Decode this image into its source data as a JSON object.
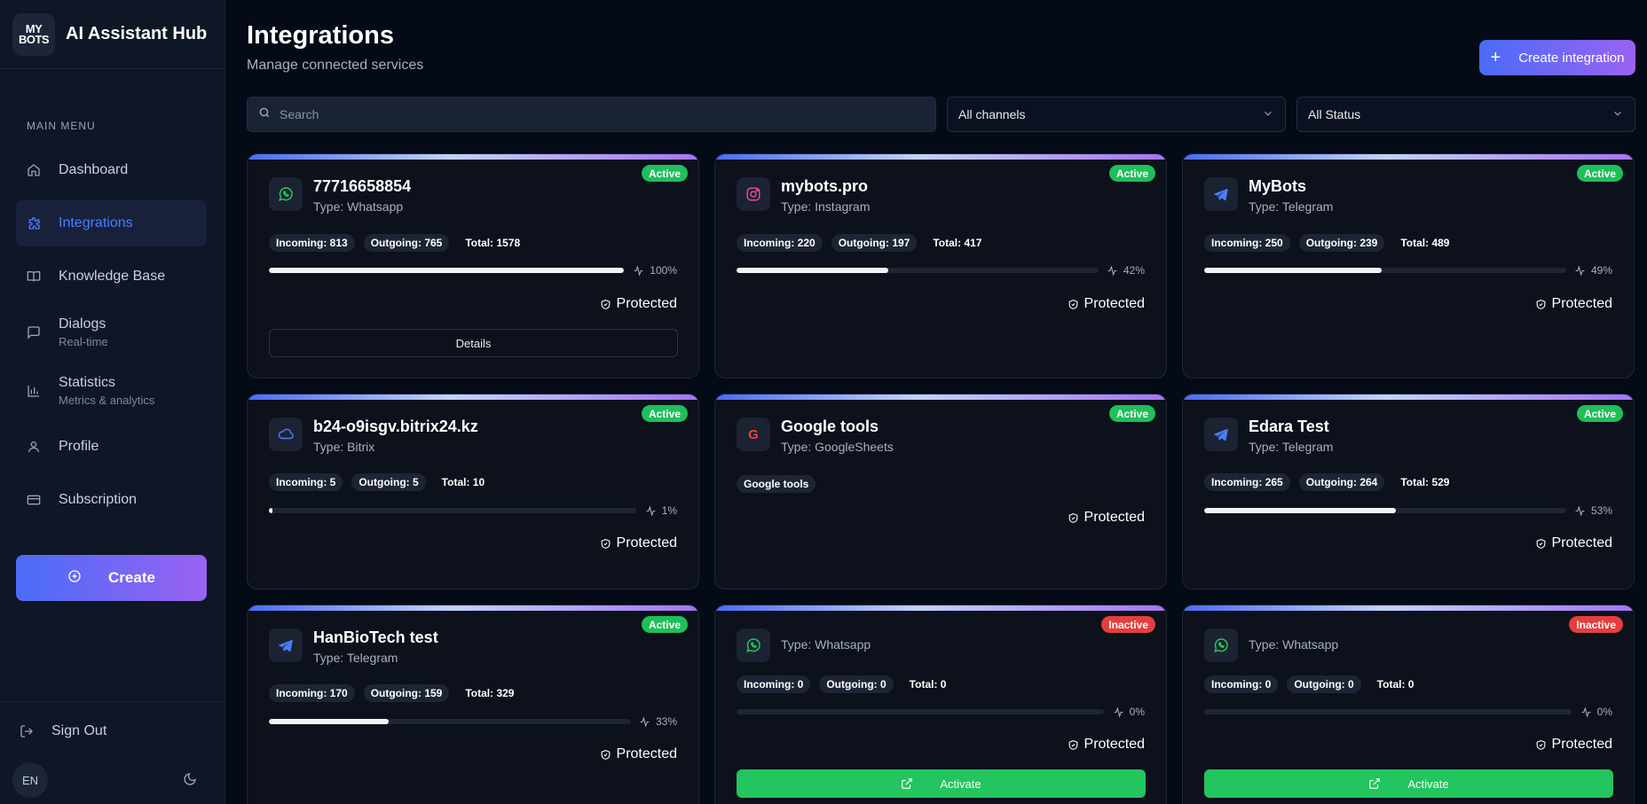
{
  "brand": {
    "logo_line1": "MY",
    "logo_line2": "BOTS",
    "name": "AI Assistant Hub"
  },
  "sidebar": {
    "menu_label": "MAIN MENU",
    "items": [
      {
        "label": "Dashboard",
        "sub": "",
        "icon": "home-icon"
      },
      {
        "label": "Integrations",
        "sub": "",
        "icon": "puzzle-icon",
        "active": true
      },
      {
        "label": "Knowledge Base",
        "sub": "",
        "icon": "book-icon"
      },
      {
        "label": "Dialogs",
        "sub": "Real-time",
        "icon": "message-icon"
      },
      {
        "label": "Statistics",
        "sub": "Metrics & analytics",
        "icon": "bar-chart-icon"
      },
      {
        "label": "Profile",
        "sub": "",
        "icon": "user-icon"
      },
      {
        "label": "Subscription",
        "sub": "",
        "icon": "credit-card-icon"
      }
    ],
    "create_label": "Create",
    "signout_label": "Sign Out",
    "lang": "EN"
  },
  "header": {
    "title": "Integrations",
    "subtitle": "Manage connected services",
    "create_label": "Create integration"
  },
  "filters": {
    "search_placeholder": "Search",
    "channel": "All channels",
    "status": "All Status"
  },
  "cards": [
    {
      "title": "77716658854",
      "type": "Type: Whatsapp",
      "status": "Active",
      "incoming": "Incoming: 813",
      "outgoing": "Outgoing: 765",
      "total": "Total: 1578",
      "percent": "100%",
      "progress": 1.0,
      "protected": "Protected",
      "button": "Details"
    },
    {
      "title": "mybots.pro",
      "type": "Type: Instagram",
      "status": "Active",
      "incoming": "Incoming: 220",
      "outgoing": "Outgoing: 197",
      "total": "Total: 417",
      "percent": "42%",
      "progress": 0.42,
      "protected": "Protected"
    },
    {
      "title": "MyBots",
      "type": "Type: Telegram",
      "status": "Active",
      "incoming": "Incoming: 250",
      "outgoing": "Outgoing: 239",
      "total": "Total: 489",
      "percent": "49%",
      "progress": 0.49,
      "protected": "Protected"
    },
    {
      "title": "b24-o9isgv.bitrix24.kz",
      "type": "Type: Bitrix",
      "status": "Active",
      "incoming": "Incoming: 5",
      "outgoing": "Outgoing: 5",
      "total": "Total: 10",
      "percent": "1%",
      "progress": 0.01,
      "protected": "Protected"
    },
    {
      "title": "Google tools",
      "type": "Type: GoogleSheets",
      "status": "Active",
      "tag": "Google tools",
      "protected": "Protected"
    },
    {
      "title": "Edara Test",
      "type": "Type: Telegram",
      "status": "Active",
      "incoming": "Incoming: 265",
      "outgoing": "Outgoing: 264",
      "total": "Total: 529",
      "percent": "53%",
      "progress": 0.53,
      "protected": "Protected"
    },
    {
      "title": "HanBioTech test",
      "type": "Type: Telegram",
      "status": "Active",
      "incoming": "Incoming: 170",
      "outgoing": "Outgoing: 159",
      "total": "Total: 329",
      "percent": "33%",
      "progress": 0.33,
      "protected": "Protected"
    },
    {
      "title": "",
      "type": "Type: Whatsapp",
      "status": "Inactive",
      "incoming": "Incoming: 0",
      "outgoing": "Outgoing: 0",
      "total": "Total: 0",
      "percent": "0%",
      "progress": 0,
      "protected": "Protected",
      "button": "Activate"
    },
    {
      "title": "",
      "type": "Type: Whatsapp",
      "status": "Inactive",
      "incoming": "Incoming: 0",
      "outgoing": "Outgoing: 0",
      "total": "Total: 0",
      "percent": "0%",
      "progress": 0,
      "protected": "Protected",
      "button": "Activate"
    }
  ],
  "colors": {
    "accent": "#4a7cff",
    "active": "#1fbf5a",
    "inactive": "#e53e3e",
    "activate": "#22c55e"
  }
}
